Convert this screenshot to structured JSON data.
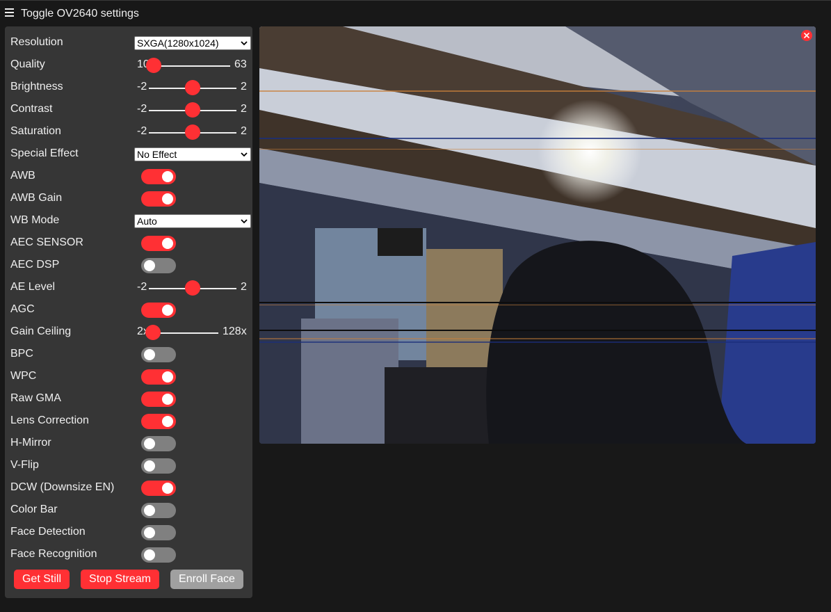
{
  "header": {
    "toggle_label": "Toggle OV2640 settings"
  },
  "controls": [
    {
      "label": "Resolution",
      "type": "select",
      "value": "SXGA(1280x1024)"
    },
    {
      "label": "Quality",
      "type": "range",
      "min": "10",
      "max": "63",
      "value": 10
    },
    {
      "label": "Brightness",
      "type": "range",
      "min": "-2",
      "max": "2",
      "value": 0
    },
    {
      "label": "Contrast",
      "type": "range",
      "min": "-2",
      "max": "2",
      "value": 0
    },
    {
      "label": "Saturation",
      "type": "range",
      "min": "-2",
      "max": "2",
      "value": 0
    },
    {
      "label": "Special Effect",
      "type": "select",
      "value": "No Effect"
    },
    {
      "label": "AWB",
      "type": "switch",
      "on": true
    },
    {
      "label": "AWB Gain",
      "type": "switch",
      "on": true
    },
    {
      "label": "WB Mode",
      "type": "select",
      "value": "Auto"
    },
    {
      "label": "AEC SENSOR",
      "type": "switch",
      "on": true
    },
    {
      "label": "AEC DSP",
      "type": "switch",
      "on": false
    },
    {
      "label": "AE Level",
      "type": "range",
      "min": "-2",
      "max": "2",
      "value": 0
    },
    {
      "label": "AGC",
      "type": "switch",
      "on": true
    },
    {
      "label": "Gain Ceiling",
      "type": "range",
      "min": "2x",
      "max": "128x",
      "value": 0
    },
    {
      "label": "BPC",
      "type": "switch",
      "on": false
    },
    {
      "label": "WPC",
      "type": "switch",
      "on": true
    },
    {
      "label": "Raw GMA",
      "type": "switch",
      "on": true
    },
    {
      "label": "Lens Correction",
      "type": "switch",
      "on": true
    },
    {
      "label": "H-Mirror",
      "type": "switch",
      "on": false
    },
    {
      "label": "V-Flip",
      "type": "switch",
      "on": false
    },
    {
      "label": "DCW (Downsize EN)",
      "type": "switch",
      "on": true
    },
    {
      "label": "Color Bar",
      "type": "switch",
      "on": false
    },
    {
      "label": "Face Detection",
      "type": "switch",
      "on": false
    },
    {
      "label": "Face Recognition",
      "type": "switch",
      "on": false
    }
  ],
  "buttons": {
    "get_still": "Get Still",
    "stop_stream": "Stop Stream",
    "enroll_face": "Enroll Face"
  },
  "colors": {
    "accent": "#ff3034",
    "panel": "#363636",
    "background": "#181818",
    "switch_off": "#808080",
    "disabled_button": "#a0a0a0"
  },
  "icons": {
    "menu": "hamburger-icon",
    "close": "close-icon",
    "select_arrow": "chevron-down-icon"
  }
}
